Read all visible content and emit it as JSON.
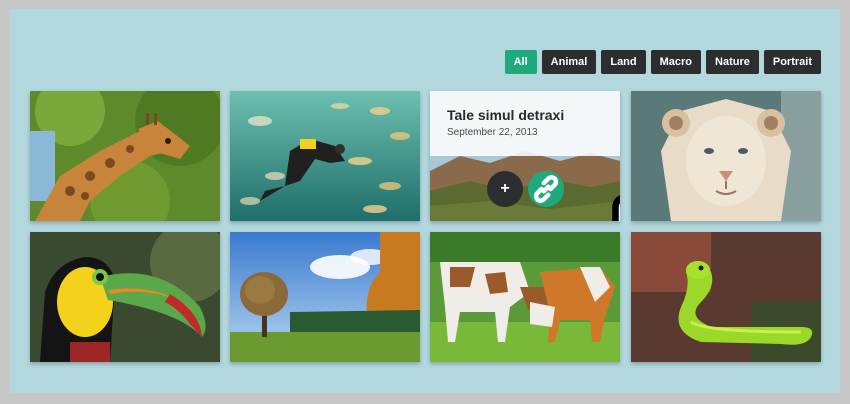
{
  "filters": [
    {
      "label": "All",
      "active": true
    },
    {
      "label": "Animal",
      "active": false
    },
    {
      "label": "Land",
      "active": false
    },
    {
      "label": "Macro",
      "active": false
    },
    {
      "label": "Nature",
      "active": false
    },
    {
      "label": "Portrait",
      "active": false
    }
  ],
  "gallery": {
    "items": [
      {
        "subject": "giraffe"
      },
      {
        "subject": "diver-with-fish"
      },
      {
        "subject": "canyon-landscape",
        "caption": {
          "title": "Tale simul detraxi",
          "date": "September 22, 2013"
        }
      },
      {
        "subject": "white-lion"
      },
      {
        "subject": "toucan"
      },
      {
        "subject": "autumn-tree"
      },
      {
        "subject": "cows"
      },
      {
        "subject": "green-snake"
      }
    ],
    "hover_actions": {
      "plus_label": "+",
      "link_icon": "link-icon"
    }
  },
  "colors": {
    "page_bg": "#b2d8de",
    "button_dark": "#2b2d2e",
    "button_active": "#1faa7c"
  }
}
